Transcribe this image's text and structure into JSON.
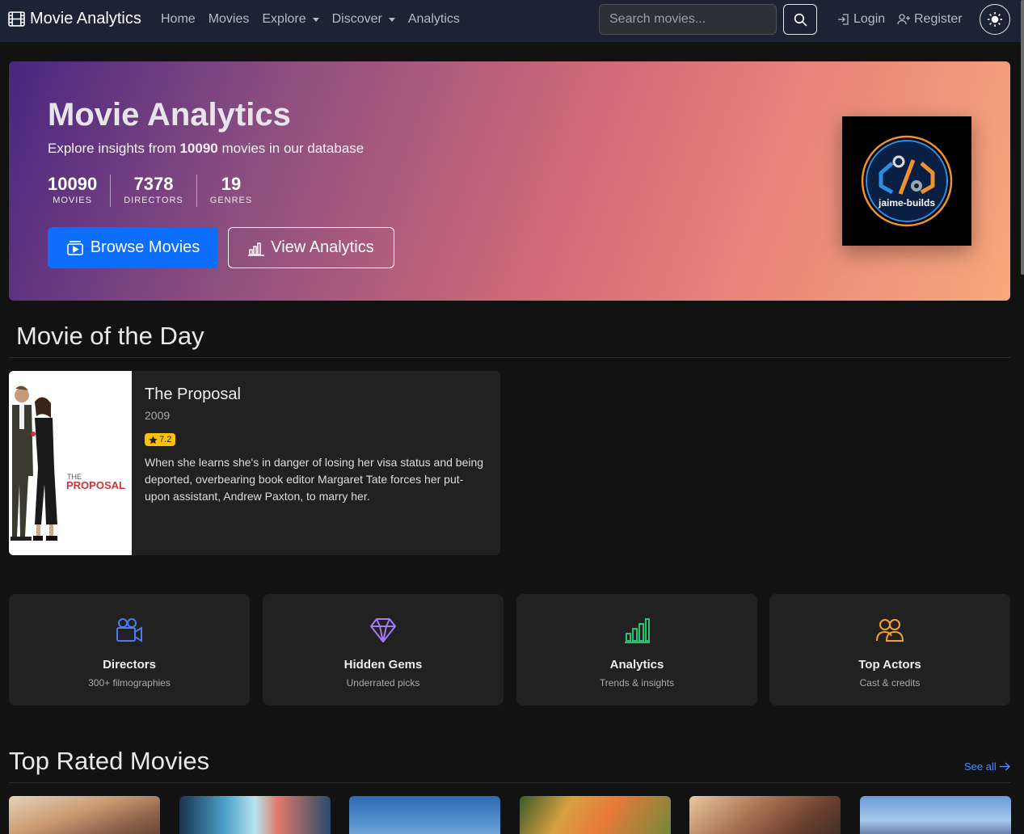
{
  "navbar": {
    "brand": "Movie Analytics",
    "links": [
      {
        "label": "Home",
        "dropdown": false
      },
      {
        "label": "Movies",
        "dropdown": false
      },
      {
        "label": "Explore",
        "dropdown": true
      },
      {
        "label": "Discover",
        "dropdown": true
      },
      {
        "label": "Analytics",
        "dropdown": false
      }
    ],
    "search_placeholder": "Search movies...",
    "login_label": "Login",
    "register_label": "Register"
  },
  "hero": {
    "title": "Movie Analytics",
    "subtitle_prefix": "Explore insights from ",
    "subtitle_count": "10090",
    "subtitle_suffix": " movies in our database",
    "stats": [
      {
        "value": "10090",
        "label": "MOVIES"
      },
      {
        "value": "7378",
        "label": "DIRECTORS"
      },
      {
        "value": "19",
        "label": "GENRES"
      }
    ],
    "browse_label": "Browse Movies",
    "analytics_label": "View Analytics",
    "logo_text": "jaime-builds"
  },
  "movie_of_day": {
    "section_title": "Movie of the Day",
    "title": "The Proposal",
    "year": "2009",
    "rating": "7.2",
    "description": "When she learns she's in danger of losing her visa status and being deported, overbearing book editor Margaret Tate forces her put-upon assistant, Andrew Paxton, to marry her.",
    "poster_text_1": "THE",
    "poster_text_2": "PROPOSAL"
  },
  "features": [
    {
      "title": "Directors",
      "subtitle": "300+ filmographies",
      "icon": "camera-video-icon",
      "color": "#4b7bec"
    },
    {
      "title": "Hidden Gems",
      "subtitle": "Underrated picks",
      "icon": "gem-icon",
      "color": "#a37bf5"
    },
    {
      "title": "Analytics",
      "subtitle": "Trends & insights",
      "icon": "bar-chart-icon",
      "color": "#2fbf71"
    },
    {
      "title": "Top Actors",
      "subtitle": "Cast & credits",
      "icon": "people-icon",
      "color": "#f59f2c"
    }
  ],
  "top_rated": {
    "section_title": "Top Rated Movies",
    "see_all": "See all"
  },
  "colors": {
    "navbar": "#1b2334",
    "primary": "#0d6efd",
    "rating": "#ffc107",
    "card": "#212121",
    "background": "#121212"
  }
}
